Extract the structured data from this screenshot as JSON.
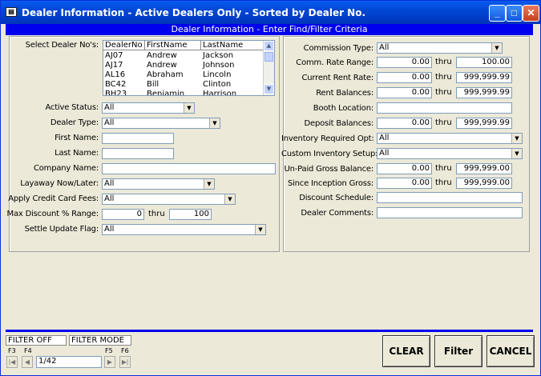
{
  "window": {
    "title": "Dealer Information - Active Dealers Only - Sorted by Dealer No."
  },
  "header": {
    "text": "Dealer Information - Enter Find/Filter Criteria"
  },
  "left": {
    "select_label": "Select Dealer No's:",
    "list_headers": [
      "DealerNo",
      "FirstName",
      "LastName"
    ],
    "list_rows": [
      [
        "AJ07",
        "Andrew",
        "Jackson"
      ],
      [
        "AJ17",
        "Andrew",
        "Johnson"
      ],
      [
        "AL16",
        "Abraham",
        "Lincoln"
      ],
      [
        "BC42",
        "Bill",
        "Clinton"
      ],
      [
        "BH23",
        "Benjamin",
        "Harrison"
      ]
    ],
    "active_status": {
      "label": "Active Status:",
      "value": "All"
    },
    "dealer_type": {
      "label": "Dealer Type:",
      "value": "All"
    },
    "first_name": {
      "label": "First Name:",
      "value": ""
    },
    "last_name": {
      "label": "Last Name:",
      "value": ""
    },
    "company_name": {
      "label": "Company Name:",
      "value": ""
    },
    "layaway": {
      "label": "Layaway Now/Later:",
      "value": "All"
    },
    "credit_fees": {
      "label": "Apply Credit Card Fees:",
      "value": "All"
    },
    "max_discount": {
      "label": "Max Discount % Range:",
      "from": "0",
      "thru": "thru",
      "to": "100"
    },
    "settle_flag": {
      "label": "Settle Update Flag:",
      "value": "All"
    }
  },
  "right": {
    "commission_type": {
      "label": "Commission Type:",
      "value": "All"
    },
    "comm_rate": {
      "label": "Comm. Rate Range:",
      "from": "0.00",
      "thru": "thru",
      "to": "100.00"
    },
    "current_rent": {
      "label": "Current Rent Rate:",
      "from": "0.00",
      "thru": "thru",
      "to": "999,999.99"
    },
    "rent_balances": {
      "label": "Rent Balances:",
      "from": "0.00",
      "thru": "thru",
      "to": "999,999.99"
    },
    "booth_location": {
      "label": "Booth Location:",
      "value": ""
    },
    "deposit_balances": {
      "label": "Deposit Balances:",
      "from": "0.00",
      "thru": "thru",
      "to": "999,999.99"
    },
    "inventory_required": {
      "label": "Inventory Required Opt:",
      "value": "All"
    },
    "custom_inventory": {
      "label": "Custom Inventory Setup:",
      "value": "All"
    },
    "unpaid_gross": {
      "label": "Un-Paid Gross Balance:",
      "from": "0.00",
      "thru": "thru",
      "to": "999,999.00"
    },
    "since_inception": {
      "label": "Since Inception Gross:",
      "from": "0.00",
      "thru": "thru",
      "to": "999,999.00"
    },
    "discount_schedule": {
      "label": "Discount Schedule:",
      "value": ""
    },
    "dealer_comments": {
      "label": "Dealer Comments:",
      "value": ""
    }
  },
  "footer": {
    "filter_status": "FILTER OFF",
    "filter_mode": "FILTER MODE",
    "fkeys": [
      "F3",
      "F4",
      "F5",
      "F6"
    ],
    "record": "1/42",
    "clear": "CLEAR",
    "filter": "Filter",
    "cancel": "CANCEL"
  }
}
